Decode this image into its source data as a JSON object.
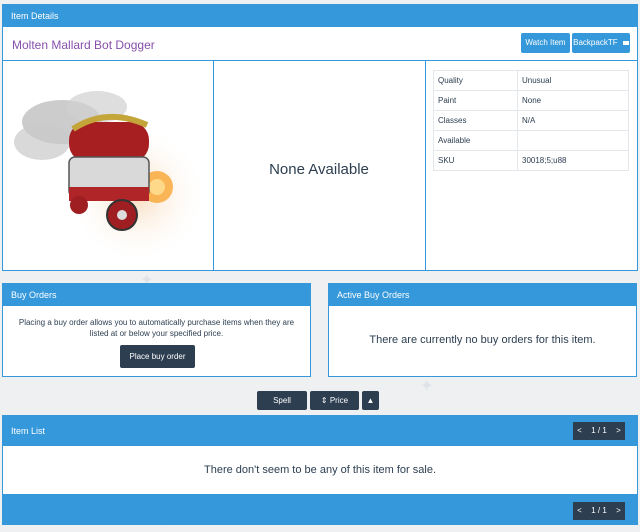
{
  "item_details": {
    "header": "Item Details",
    "item_name": "Molten Mallard Bot Dogger",
    "watch_button": "Watch Item",
    "backpack_button": "BackpackTF",
    "none_available": "None Available",
    "attributes": [
      {
        "label": "Quality",
        "value": "Unusual"
      },
      {
        "label": "Paint",
        "value": "None"
      },
      {
        "label": "Classes",
        "value": "N/A"
      },
      {
        "label": "Available",
        "value": ""
      },
      {
        "label": "SKU",
        "value": "30018;5;u88"
      }
    ]
  },
  "buy_orders": {
    "header": "Buy Orders",
    "description": "Placing a buy order allows you to automatically purchase items when they are listed at or below your specified price.",
    "place_button": "Place buy order"
  },
  "active_buy_orders": {
    "header": "Active Buy Orders",
    "empty_text": "There are currently no buy orders for this item."
  },
  "sort_bar": {
    "spell_label": "Spell",
    "price_label": "Price",
    "price_icon": "sort-icon",
    "direction_icon": "arrow-up-icon"
  },
  "item_list": {
    "header": "Item List",
    "empty_text": "There don't seem to be any of this item for sale.",
    "pager": {
      "prev": "<",
      "page": "1 / 1",
      "next": ">"
    }
  },
  "colors": {
    "accent": "#3498db",
    "dark": "#2c3e50",
    "item_name": "#8650ac"
  }
}
